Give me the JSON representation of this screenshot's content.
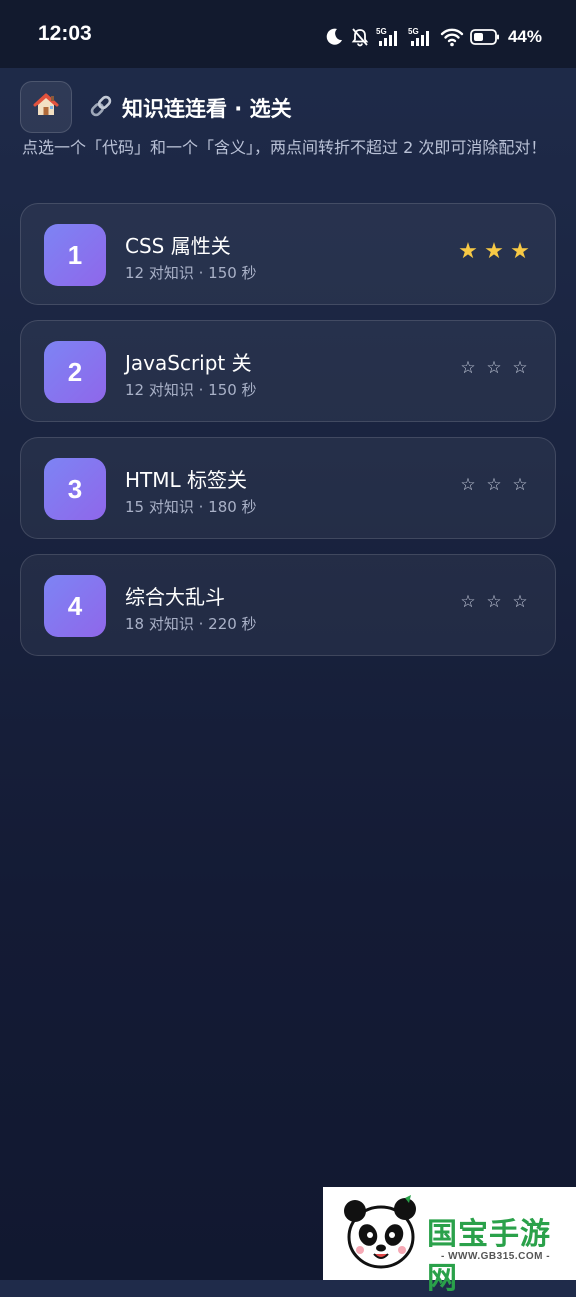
{
  "status_bar": {
    "time": "12:03",
    "network_label_1": "5G",
    "network_label_2": "5G",
    "battery_percent": "44%",
    "icons": [
      "moon-icon",
      "bell-muted-icon",
      "signal-icon",
      "signal-icon",
      "wifi-icon",
      "battery-icon"
    ]
  },
  "header": {
    "home_icon": "house-emoji-icon",
    "title_icon": "link-emoji-icon",
    "title": "知识连连看 · 选关",
    "subtitle": "点选一个「代码」和一个「含义」，两点间转折不超过 2 次即可消除配对！"
  },
  "levels": [
    {
      "number": "1",
      "name": "CSS 属性关",
      "meta": "12 对知识 · 150 秒",
      "stars_earned": 3,
      "stars_total": 3
    },
    {
      "number": "2",
      "name": "JavaScript 关",
      "meta": "12 对知识 · 150 秒",
      "stars_earned": 0,
      "stars_total": 3
    },
    {
      "number": "3",
      "name": "HTML 标签关",
      "meta": "15 对知识 · 180 秒",
      "stars_earned": 0,
      "stars_total": 3
    },
    {
      "number": "4",
      "name": "综合大乱斗",
      "meta": "18 对知识 · 220 秒",
      "stars_earned": 0,
      "stars_total": 3
    }
  ],
  "stars": {
    "filled_glyph": "★",
    "empty_glyph": "☆",
    "filled_color": "#f7c945",
    "empty_color": "#c7cddd"
  },
  "colors": {
    "accent_gradient_start": "#7d84f4",
    "accent_gradient_end": "#8f67ea",
    "background": "#1a2440"
  },
  "watermark": {
    "text": "国宝手游网",
    "url": "- WWW.GB315.COM -"
  }
}
